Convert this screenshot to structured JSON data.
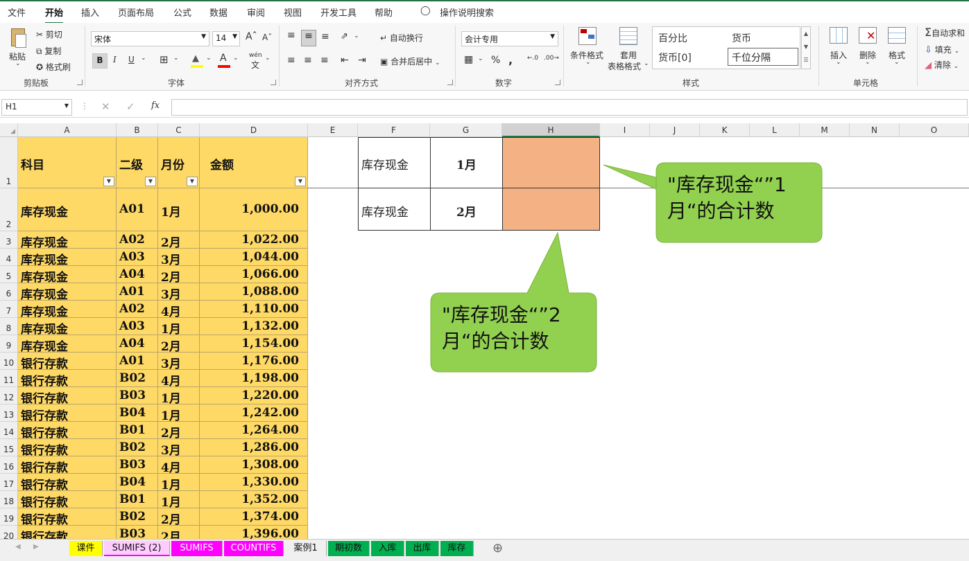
{
  "menu": [
    "文件",
    "开始",
    "插入",
    "页面布局",
    "公式",
    "数据",
    "审阅",
    "视图",
    "开发工具",
    "帮助",
    "操作说明搜索"
  ],
  "ribbon": {
    "clipboard": {
      "paste": "粘贴",
      "cut": "剪切",
      "copy": "复制",
      "format_painter": "格式刷",
      "label": "剪贴板"
    },
    "font": {
      "name": "宋体",
      "size": "14",
      "label": "字体",
      "bold": "B",
      "italic": "I",
      "underline": "U",
      "wen": "wén"
    },
    "align": {
      "wrap": "自动换行",
      "merge": "合并后居中",
      "label": "对齐方式"
    },
    "number": {
      "format": "会计专用",
      "label": "数字",
      "percent": "%"
    },
    "styles": {
      "cond": "条件格式",
      "table_line1": "套用",
      "table_line2": "表格格式",
      "s1": "百分比",
      "s2": "货币",
      "s3": "货币[0]",
      "s4": "千位分隔",
      "label": "样式"
    },
    "cells": {
      "insert": "插入",
      "delete": "删除",
      "format": "格式",
      "label": "单元格"
    },
    "edit": {
      "autosum": "自动求和",
      "fill": "填充",
      "clear": "清除"
    }
  },
  "formula_bar": {
    "name_box": "H1",
    "fx": "fx",
    "value": ""
  },
  "columns": [
    "A",
    "B",
    "C",
    "D",
    "E",
    "F",
    "G",
    "H",
    "I",
    "J",
    "K",
    "L",
    "M",
    "N",
    "O"
  ],
  "headers": {
    "a": "科目",
    "b": "二级",
    "c": "月份",
    "d": "金额"
  },
  "rows": [
    [
      "库存现金",
      "A01",
      "1月",
      "1,000.00"
    ],
    [
      "库存现金",
      "A02",
      "2月",
      "1,022.00"
    ],
    [
      "库存现金",
      "A03",
      "3月",
      "1,044.00"
    ],
    [
      "库存现金",
      "A04",
      "2月",
      "1,066.00"
    ],
    [
      "库存现金",
      "A01",
      "3月",
      "1,088.00"
    ],
    [
      "库存现金",
      "A02",
      "4月",
      "1,110.00"
    ],
    [
      "库存现金",
      "A03",
      "1月",
      "1,132.00"
    ],
    [
      "库存现金",
      "A04",
      "2月",
      "1,154.00"
    ],
    [
      "银行存款",
      "A01",
      "3月",
      "1,176.00"
    ],
    [
      "银行存款",
      "B02",
      "4月",
      "1,198.00"
    ],
    [
      "银行存款",
      "B03",
      "1月",
      "1,220.00"
    ],
    [
      "银行存款",
      "B04",
      "1月",
      "1,242.00"
    ],
    [
      "银行存款",
      "B01",
      "2月",
      "1,264.00"
    ],
    [
      "银行存款",
      "B02",
      "3月",
      "1,286.00"
    ],
    [
      "银行存款",
      "B03",
      "4月",
      "1,308.00"
    ],
    [
      "银行存款",
      "B04",
      "1月",
      "1,330.00"
    ],
    [
      "银行存款",
      "B01",
      "1月",
      "1,352.00"
    ],
    [
      "银行存款",
      "B02",
      "2月",
      "1,374.00"
    ],
    [
      "银行存款",
      "B03",
      "2月",
      "1,396.00"
    ]
  ],
  "side_table": [
    {
      "label": "库存现金",
      "month": "1月"
    },
    {
      "label": "库存现金",
      "month": "2月"
    }
  ],
  "callouts": {
    "c1_line1": "\"库存现金“”1",
    "c1_line2": "月“的合计数",
    "c2_line1": "\"库存现金“”2",
    "c2_line2": "月“的合计数"
  },
  "colors": {
    "header_fill": "#ffd966",
    "result_fill": "#f4b183",
    "callout_fill": "#92d050",
    "accent": "#217346"
  },
  "tabs": [
    {
      "label": "课件",
      "color": "#ffff00"
    },
    {
      "label": "SUMIFS (2)",
      "color": "#ffccff"
    },
    {
      "label": "SUMIFS",
      "color": "#ff00ff"
    },
    {
      "label": "COUNTIFS",
      "color": "#ff00ff"
    },
    {
      "label": "案例1",
      "color": "#f0f0f0"
    },
    {
      "label": "期初数",
      "color": "#00b050"
    },
    {
      "label": "入库",
      "color": "#00b050"
    },
    {
      "label": "出库",
      "color": "#00b050"
    },
    {
      "label": "库存",
      "color": "#00b050"
    }
  ]
}
